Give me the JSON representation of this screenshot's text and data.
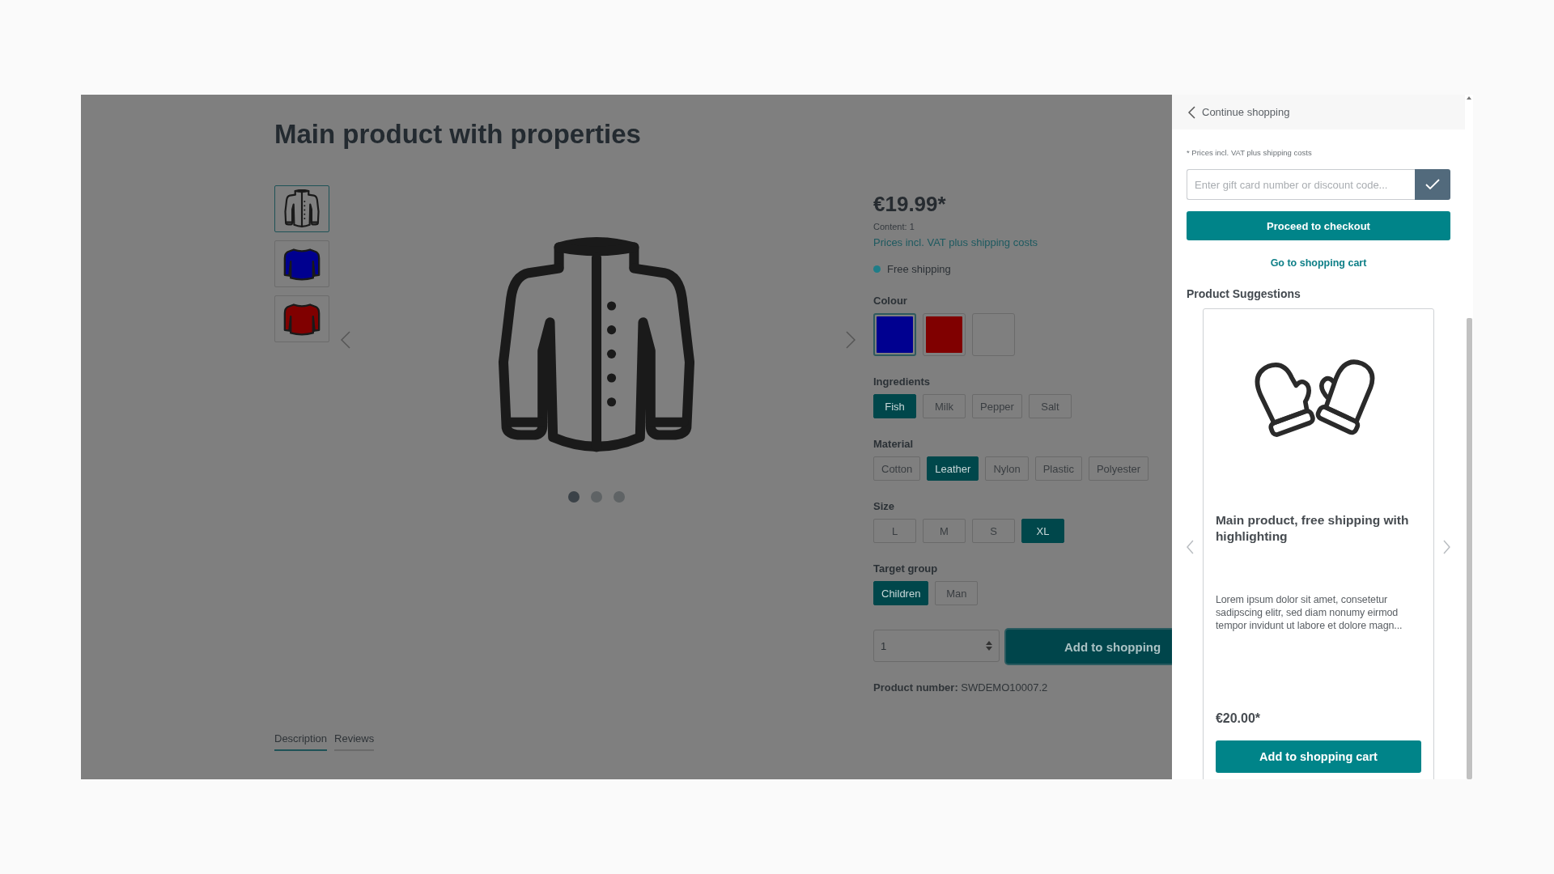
{
  "product": {
    "title": "Main product with properties",
    "price": "€19.99*",
    "content": "Content: 1",
    "tax_note": "Prices incl. VAT plus shipping costs",
    "shipping": "Free shipping",
    "quantity": "1",
    "buy_button": "Add to shopping",
    "product_number_label": "Product number:",
    "product_number": "SWDEMO10007.2"
  },
  "thumbnails": [
    {
      "kind": "jacket",
      "selected": true
    },
    {
      "kind": "shirt",
      "color": "#00008f",
      "selected": false
    },
    {
      "kind": "shirt",
      "color": "#800000",
      "selected": false
    }
  ],
  "slider_dots": [
    {
      "selected": true
    },
    {
      "selected": false
    },
    {
      "selected": false
    }
  ],
  "options": [
    {
      "label": "Colour",
      "kind": "swatch",
      "values": [
        {
          "color": "#000090",
          "selected": true
        },
        {
          "color": "#800000",
          "selected": false
        },
        {
          "selected": false
        }
      ]
    },
    {
      "label": "Ingredients",
      "kind": "text",
      "values": [
        {
          "label": "Fish",
          "selected": true
        },
        {
          "label": "Milk",
          "selected": false
        },
        {
          "label": "Pepper",
          "selected": false
        },
        {
          "label": "Salt",
          "selected": false
        }
      ]
    },
    {
      "label": "Material",
      "kind": "text",
      "values": [
        {
          "label": "Cotton",
          "selected": false
        },
        {
          "label": "Leather",
          "selected": true
        },
        {
          "label": "Nylon",
          "selected": false
        },
        {
          "label": "Plastic",
          "selected": false
        },
        {
          "label": "Polyester",
          "selected": false
        }
      ]
    },
    {
      "label": "Size",
      "kind": "text",
      "values": [
        {
          "label": "L",
          "selected": false
        },
        {
          "label": "M",
          "selected": false
        },
        {
          "label": "S",
          "selected": false
        },
        {
          "label": "XL",
          "selected": true
        }
      ]
    },
    {
      "label": "Target group",
      "kind": "text",
      "values": [
        {
          "label": "Children",
          "selected": true
        },
        {
          "label": "Man",
          "selected": false
        }
      ]
    }
  ],
  "tabs": [
    {
      "label": "Description",
      "selected": true
    },
    {
      "label": "Reviews",
      "selected": false
    }
  ],
  "sidebar": {
    "back_link": "Continue shopping",
    "price_note": "* Prices incl. VAT plus shipping costs",
    "voucher": {
      "placeholder": "Enter gift card number or discount code..."
    },
    "checkout_button": "Proceed to checkout",
    "cart_link": "Go to shopping cart",
    "suggestions_title": "Product Suggestions",
    "suggestions": [
      {
        "name": "Main product, free shipping with highlighting",
        "description": "Lorem ipsum dolor sit amet, consetetur sadipscing elitr, sed diam nonumy eirmod tempor invidunt ut labore et dolore magn...",
        "price": "€20.00*",
        "button": "Add to shopping cart"
      }
    ]
  }
}
